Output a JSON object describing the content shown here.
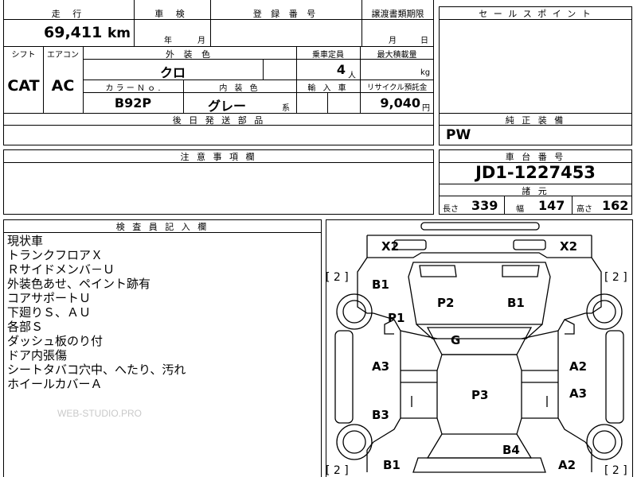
{
  "top_table": {
    "mileage_label": "走 行",
    "mileage_value": "69,411",
    "mileage_unit": "km",
    "inspection_label": "車 検",
    "inspection_year": "年",
    "inspection_month": "月",
    "reg_number_label": "登 録 番 号",
    "transfer_label": "譲渡書類期限",
    "transfer_month": "月",
    "transfer_day": "日",
    "shift_label": "シフト",
    "shift_value": "CAT",
    "aircon_label": "エアコン",
    "aircon_value": "AC",
    "exterior_label": "外 装 色",
    "exterior_value": "クロ",
    "capacity_label": "乗車定員",
    "capacity_value": "4",
    "capacity_unit": "人",
    "max_load_label": "最大積載量",
    "max_load_unit": "kg",
    "color_no_label": "カ ラ ー Ｎ ｏ .",
    "color_no_value": "B92P",
    "interior_label": "内 装 色",
    "interior_value": "グレー",
    "interior_suffix": "系",
    "import_label": "輸 入 車",
    "recycle_label": "リサイクル預託金",
    "recycle_value": "9,040",
    "recycle_unit": "円",
    "parts_label": "後 日 発 送 部 品"
  },
  "sales_point": {
    "label": "セ ー ル ス ポ イ ン ト"
  },
  "genuine_equipment": {
    "label": "純 正 装 備",
    "value": "PW"
  },
  "caution": {
    "label": "注 意 事 項 欄"
  },
  "chassis": {
    "label": "車 台 番 号",
    "value": "JD1-1227453",
    "specs_label": "諸 元",
    "length_label": "長さ",
    "length_value": "339",
    "width_label": "幅",
    "width_value": "147",
    "height_label": "高さ",
    "height_value": "162"
  },
  "inspector": {
    "label": "検 査 員 記 入 欄",
    "notes": [
      "現状車",
      "トランクフロアＸ",
      "Ｒサイドメンバ－Ｕ",
      "外装色あせ、ペイント跡有",
      "コアサポートＵ",
      "下廻りＳ、ＡＵ",
      "各部Ｓ",
      "ダッシュ板のり付",
      "ドア内張傷",
      "シートタバコ穴中、へたり、汚れ",
      "ホイールカバーＡ"
    ],
    "watermark": "WEB-STUDIO.PRO"
  },
  "diagram": {
    "marks": {
      "x2_left": "X2",
      "x2_right": "X2",
      "tire_fl": "[ 2 ]",
      "tire_fr": "[ 2 ]",
      "tire_rl": "[ 2 ]",
      "tire_rr": "[ 2 ]",
      "b1_left_front": "B1",
      "p2_hood": "P2",
      "b1_hood": "B1",
      "p1_fender": "P1",
      "g_glass": "G",
      "a3_left_door": "A3",
      "a2_right_door": "A2",
      "p3_roof": "P3",
      "a3_right_rear": "A3",
      "b3_left_rear": "B3",
      "b4_rear": "B4",
      "b1_left_rear": "B1",
      "a2_right_rear": "A2"
    }
  }
}
